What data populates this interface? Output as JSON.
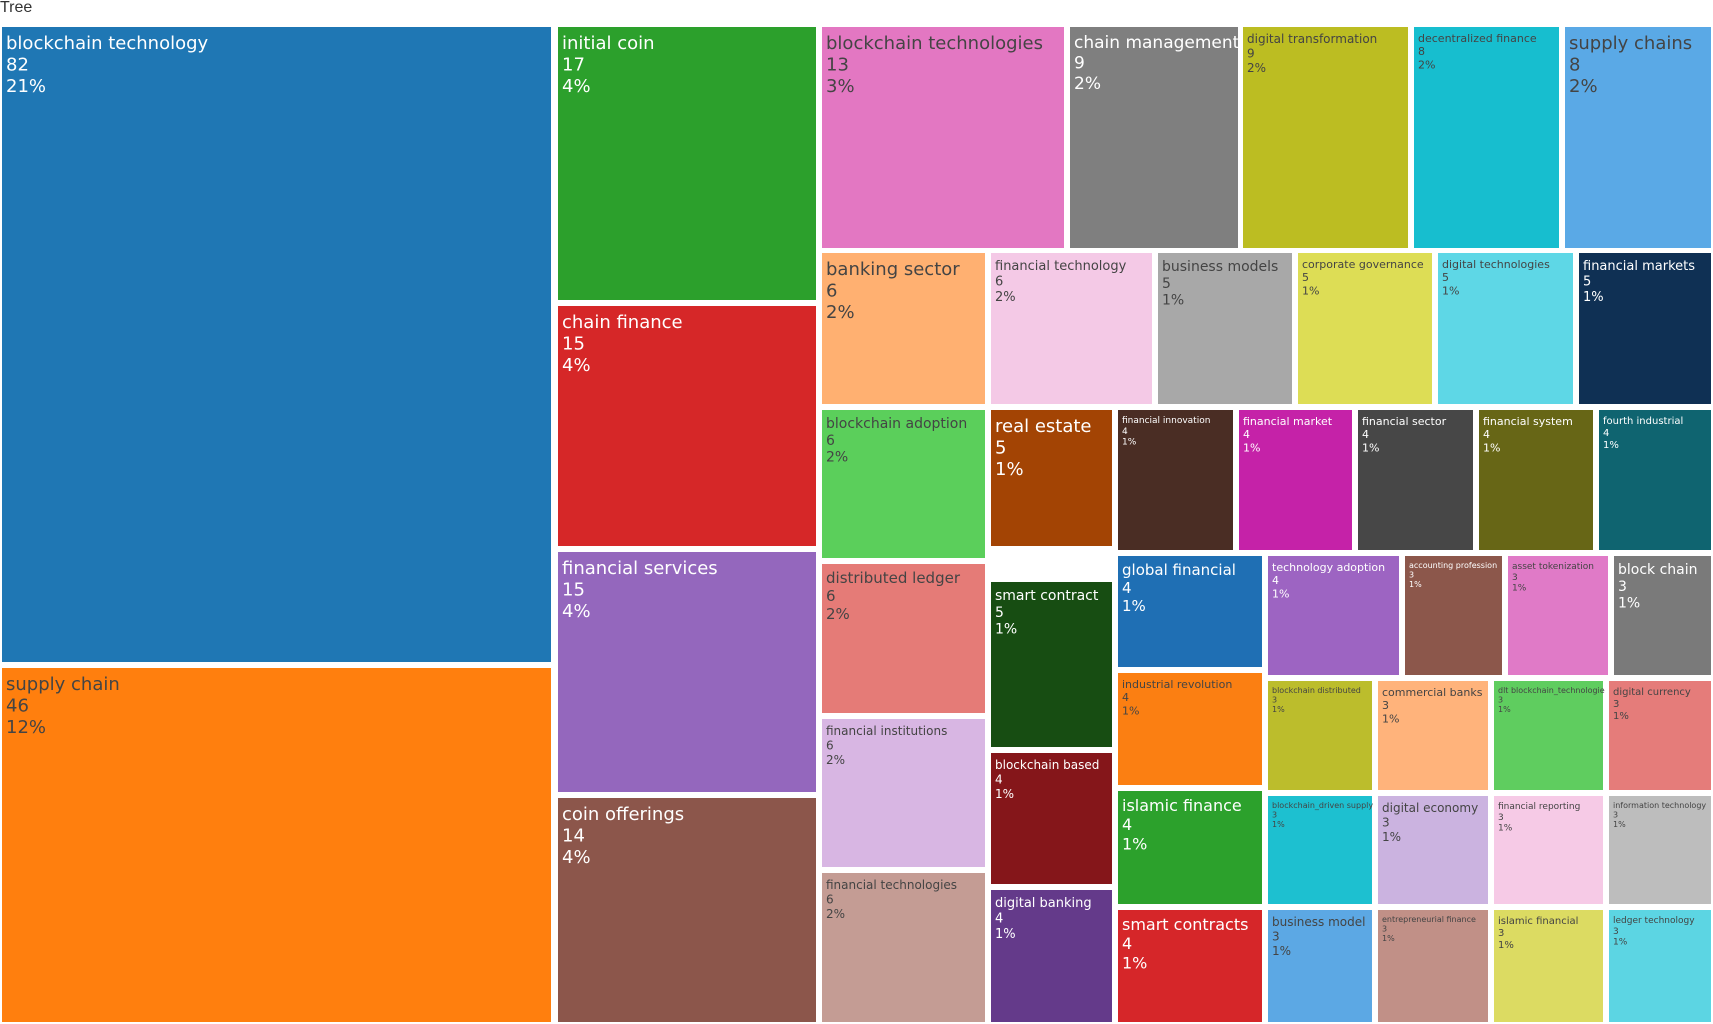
{
  "header": {
    "title": "Tree"
  },
  "chart_data": {
    "type": "treemap",
    "title": "Tree",
    "tiles": [
      {
        "label": "blockchain technology",
        "value": 82,
        "percent": "21%",
        "color": "#1f77b4"
      },
      {
        "label": "supply chain",
        "value": 46,
        "percent": "12%",
        "color": "#ff7f0e"
      },
      {
        "label": "initial coin",
        "value": 17,
        "percent": "4%",
        "color": "#2ca02c"
      },
      {
        "label": "chain finance",
        "value": 15,
        "percent": "4%",
        "color": "#d62728"
      },
      {
        "label": "financial services",
        "value": 15,
        "percent": "4%",
        "color": "#9467bd"
      },
      {
        "label": "coin offerings",
        "value": 14,
        "percent": "4%",
        "color": "#8c564b"
      },
      {
        "label": "blockchain technologies",
        "value": 13,
        "percent": "3%",
        "color": "#e377c2"
      },
      {
        "label": "chain management",
        "value": 9,
        "percent": "2%",
        "color": "#7f7f7f"
      },
      {
        "label": "digital transformation",
        "value": 9,
        "percent": "2%",
        "color": "#bcbd22"
      },
      {
        "label": "decentralized finance",
        "value": 8,
        "percent": "2%",
        "color": "#17becf"
      },
      {
        "label": "supply chains",
        "value": 8,
        "percent": "2%",
        "color": "#5aa9e6"
      },
      {
        "label": "banking sector",
        "value": 6,
        "percent": "2%",
        "color": "#ffb071"
      },
      {
        "label": "financial technology",
        "value": 6,
        "percent": "2%",
        "color": "#f4c9e6"
      },
      {
        "label": "business models",
        "value": 5,
        "percent": "1%",
        "color": "#a8a8a8"
      },
      {
        "label": "corporate governance",
        "value": 5,
        "percent": "1%",
        "color": "#dddd55"
      },
      {
        "label": "digital technologies",
        "value": 5,
        "percent": "1%",
        "color": "#5ed7e6"
      },
      {
        "label": "financial markets",
        "value": 5,
        "percent": "1%",
        "color": "#0f3054"
      },
      {
        "label": "blockchain adoption",
        "value": 6,
        "percent": "2%",
        "color": "#5bcf5b"
      },
      {
        "label": "real estate",
        "value": 5,
        "percent": "1%",
        "color": "#a34404"
      },
      {
        "label": "financial innovation",
        "value": 4,
        "percent": "1%",
        "color": "#4a2d24"
      },
      {
        "label": "financial market",
        "value": 4,
        "percent": "1%",
        "color": "#c522a8"
      },
      {
        "label": "financial sector",
        "value": 4,
        "percent": "1%",
        "color": "#474747"
      },
      {
        "label": "financial system",
        "value": 4,
        "percent": "1%",
        "color": "#676616"
      },
      {
        "label": "fourth industrial",
        "value": 4,
        "percent": "1%",
        "color": "#0f6470"
      },
      {
        "label": "distributed ledger",
        "value": 6,
        "percent": "2%",
        "color": "#e57b77"
      },
      {
        "label": "smart contract",
        "value": 5,
        "percent": "1%",
        "color": "#174d12"
      },
      {
        "label": "global financial",
        "value": 4,
        "percent": "1%",
        "color": "#1f6fb4"
      },
      {
        "label": "technology adoption",
        "value": 4,
        "percent": "1%",
        "color": "#9d64c2"
      },
      {
        "label": "accounting profession",
        "value": 3,
        "percent": "1%",
        "color": "#8c574b"
      },
      {
        "label": "asset tokenization",
        "value": 3,
        "percent": "1%",
        "color": "#e07ac7"
      },
      {
        "label": "block chain",
        "value": 3,
        "percent": "1%",
        "color": "#7a7a7a"
      },
      {
        "label": "financial institutions",
        "value": 6,
        "percent": "2%",
        "color": "#d8b6e3"
      },
      {
        "label": "blockchain based",
        "value": 4,
        "percent": "1%",
        "color": "#85161a"
      },
      {
        "label": "industrial revolution",
        "value": 4,
        "percent": "1%",
        "color": "#fb7f12"
      },
      {
        "label": "blockchain distributed",
        "value": 3,
        "percent": "1%",
        "color": "#bcbd2c"
      },
      {
        "label": "commercial banks",
        "value": 3,
        "percent": "1%",
        "color": "#ffb37b"
      },
      {
        "label": "dlt blockchain_technologie",
        "value": 3,
        "percent": "1%",
        "color": "#5fcd5f"
      },
      {
        "label": "digital currency",
        "value": 3,
        "percent": "1%",
        "color": "#e57c7a"
      },
      {
        "label": "financial technologies",
        "value": 6,
        "percent": "2%",
        "color": "#c49c94"
      },
      {
        "label": "digital banking",
        "value": 4,
        "percent": "1%",
        "color": "#643a8a"
      },
      {
        "label": "islamic finance",
        "value": 4,
        "percent": "1%",
        "color": "#2ca12c"
      },
      {
        "label": "blockchain_driven supply",
        "value": 3,
        "percent": "1%",
        "color": "#1dc0d0"
      },
      {
        "label": "digital economy",
        "value": 3,
        "percent": "1%",
        "color": "#cbb3e0"
      },
      {
        "label": "financial reporting",
        "value": 3,
        "percent": "1%",
        "color": "#f6cae6"
      },
      {
        "label": "information technology",
        "value": 3,
        "percent": "1%",
        "color": "#bdbdbd"
      },
      {
        "label": "smart contracts",
        "value": 4,
        "percent": "1%",
        "color": "#d62629"
      },
      {
        "label": "business model",
        "value": 3,
        "percent": "1%",
        "color": "#5ca8e4"
      },
      {
        "label": "entrepreneurial finance",
        "value": 3,
        "percent": "1%",
        "color": "#c19087"
      },
      {
        "label": "islamic financial",
        "value": 3,
        "percent": "1%",
        "color": "#dcdb62"
      },
      {
        "label": "ledger technology",
        "value": 3,
        "percent": "1%",
        "color": "#5cd5e3"
      }
    ]
  }
}
